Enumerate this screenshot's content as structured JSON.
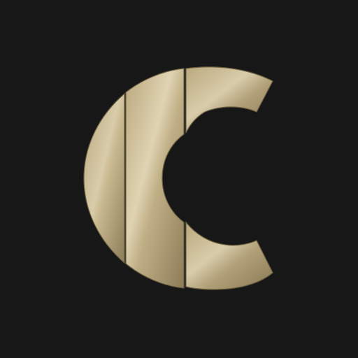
{
  "app_icon": {
    "background_color": "#171717",
    "mark": {
      "icon": "segmented-c-logo-icon",
      "segments": [
        "left-slice",
        "middle-slice",
        "right-slice"
      ],
      "colors": {
        "gold_light": "#d8caa3",
        "gold_mid": "#c2ae80",
        "gold_dark": "#8f7f58",
        "edge": "#6e6243"
      }
    }
  }
}
